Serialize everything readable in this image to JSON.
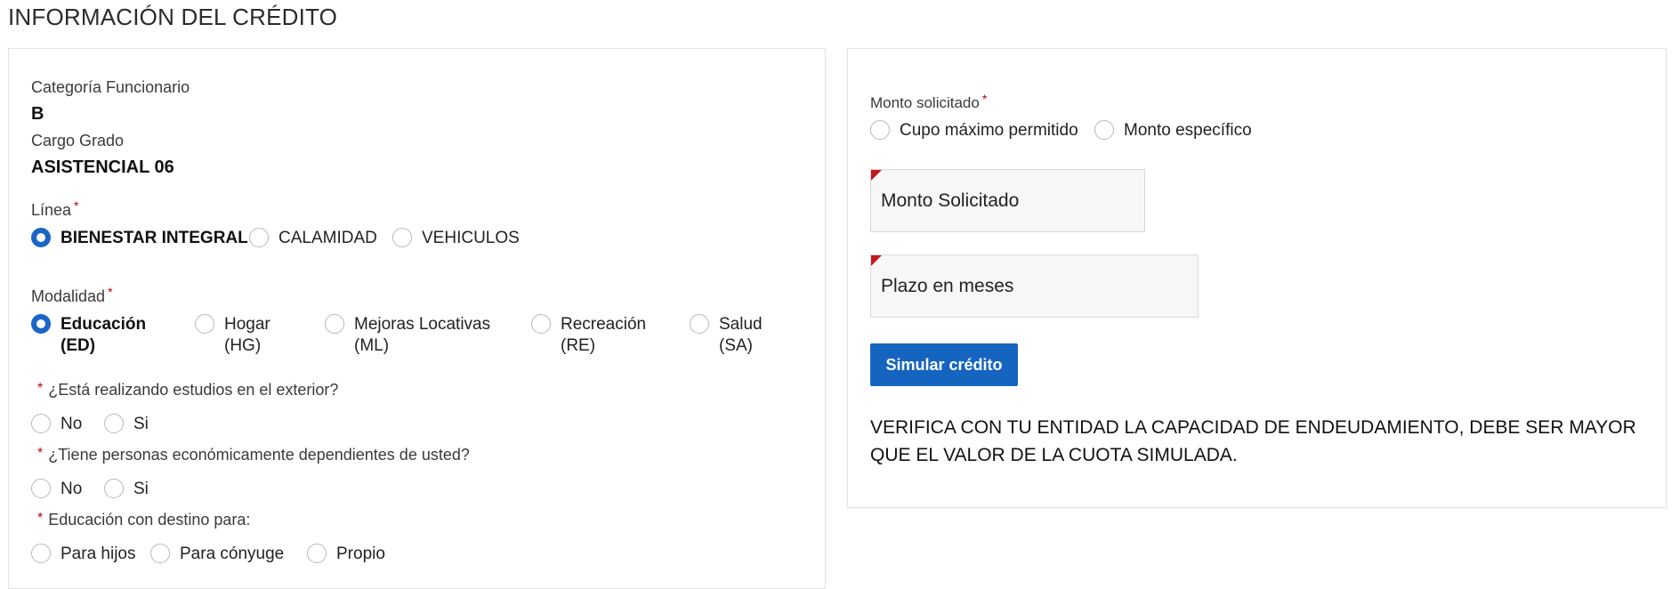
{
  "page": {
    "title": "INFORMACIÓN DEL CRÉDITO"
  },
  "left": {
    "categoria_label": "Categoría Funcionario",
    "categoria_value": "B",
    "cargo_label": "Cargo Grado",
    "cargo_value": "ASISTENCIAL 06",
    "linea": {
      "label": "Línea",
      "required_mark": "*",
      "options": [
        "BIENESTAR INTEGRAL",
        "CALAMIDAD",
        "VEHICULOS"
      ],
      "selected": "BIENESTAR INTEGRAL"
    },
    "modalidad": {
      "label": "Modalidad",
      "required_mark": "*",
      "options": [
        {
          "line1": "Educación",
          "line2": "(ED)"
        },
        {
          "line1": "Hogar",
          "line2": "(HG)"
        },
        {
          "line1": "Mejoras Locativas",
          "line2": "(ML)"
        },
        {
          "line1": "Recreación",
          "line2": "(RE)"
        },
        {
          "line1": "Salud",
          "line2": "(SA)"
        }
      ],
      "selected": "Educación"
    },
    "q1": {
      "required_mark": "*",
      "label": "¿Está realizando estudios en el exterior?",
      "options": [
        "No",
        "Si"
      ]
    },
    "q2": {
      "required_mark": "*",
      "label": "¿Tiene personas económicamente dependientes de usted?",
      "options": [
        "No",
        "Si"
      ]
    },
    "q3": {
      "required_mark": "*",
      "label": "Educación con destino para:",
      "options": [
        "Para hijos",
        "Para cónyuge",
        "Propio"
      ]
    }
  },
  "right": {
    "monto": {
      "label": "Monto solicitado",
      "required_mark": "*",
      "options": [
        "Cupo máximo permitido",
        "Monto específico"
      ]
    },
    "monto_field": {
      "placeholder": "Monto Solicitado"
    },
    "plazo_field": {
      "placeholder": "Plazo en meses"
    },
    "simulate_button": "Simular crédito",
    "notice": "VERIFICA CON TU ENTIDAD LA CAPACIDAD DE ENDEUDAMIENTO, DEBE SER MAYOR QUE EL VALOR DE LA CUOTA SIMULADA."
  },
  "colors": {
    "accent": "#1565c0",
    "required": "#c00000",
    "border": "#e3e3e3"
  }
}
